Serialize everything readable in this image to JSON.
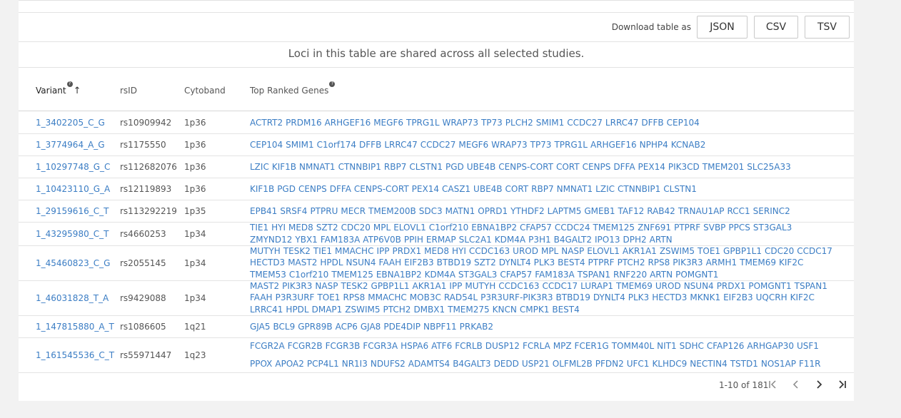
{
  "download": {
    "label": "Download table as",
    "buttons": [
      "JSON",
      "CSV",
      "TSV"
    ]
  },
  "notice": "Loci in this table are shared across all selected studies.",
  "columns": {
    "variant": "Variant",
    "rsid": "rsID",
    "cytoband": "Cytoband",
    "genes": "Top Ranked Genes"
  },
  "rows": [
    {
      "variant": "1_3402205_C_G",
      "rsid": "rs10909942",
      "cytoband": "1p36",
      "genes": [
        "ACTRT2",
        "PRDM16",
        "ARHGEF16",
        "MEGF6",
        "TPRG1L",
        "WRAP73",
        "TP73",
        "PLCH2",
        "SMIM1",
        "CCDC27",
        "LRRC47",
        "DFFB",
        "CEP104"
      ]
    },
    {
      "variant": "1_3774964_A_G",
      "rsid": "rs1175550",
      "cytoband": "1p36",
      "genes": [
        "CEP104",
        "SMIM1",
        "C1orf174",
        "DFFB",
        "LRRC47",
        "CCDC27",
        "MEGF6",
        "WRAP73",
        "TP73",
        "TPRG1L",
        "ARHGEF16",
        "NPHP4",
        "KCNAB2"
      ]
    },
    {
      "variant": "1_10297748_G_C",
      "rsid": "rs112682076",
      "cytoband": "1p36",
      "genes": [
        "LZIC",
        "KIF1B",
        "NMNAT1",
        "CTNNBIP1",
        "RBP7",
        "CLSTN1",
        "PGD",
        "UBE4B",
        "CENPS-CORT",
        "CORT",
        "CENPS",
        "DFFA",
        "PEX14",
        "PIK3CD",
        "TMEM201",
        "SLC25A33"
      ]
    },
    {
      "variant": "1_10423110_G_A",
      "rsid": "rs12119893",
      "cytoband": "1p36",
      "genes": [
        "KIF1B",
        "PGD",
        "CENPS",
        "DFFA",
        "CENPS-CORT",
        "PEX14",
        "CASZ1",
        "UBE4B",
        "CORT",
        "RBP7",
        "NMNAT1",
        "LZIC",
        "CTNNBIP1",
        "CLSTN1"
      ]
    },
    {
      "variant": "1_29159616_C_T",
      "rsid": "rs113292219",
      "cytoband": "1p35",
      "genes": [
        "EPB41",
        "SRSF4",
        "PTPRU",
        "MECR",
        "TMEM200B",
        "SDC3",
        "MATN1",
        "OPRD1",
        "YTHDF2",
        "LAPTM5",
        "GMEB1",
        "TAF12",
        "RAB42",
        "TRNAU1AP",
        "RCC1",
        "SERINC2"
      ]
    },
    {
      "variant": "1_43295980_C_T",
      "rsid": "rs4660253",
      "cytoband": "1p34",
      "genes": [
        "TIE1",
        "HYI",
        "MED8",
        "SZT2",
        "CDC20",
        "MPL",
        "ELOVL1",
        "C1orf210",
        "EBNA1BP2",
        "CFAP57",
        "CCDC24",
        "TMEM125",
        "ZNF691",
        "PTPRF",
        "SVBP",
        "PPCS",
        "ST3GAL3",
        "ZMYND12",
        "YBX1",
        "FAM183A",
        "ATP6V0B",
        "PPIH",
        "ERMAP",
        "SLC2A1",
        "KDM4A",
        "P3H1",
        "B4GALT2",
        "IPO13",
        "DPH2",
        "ARTN"
      ]
    },
    {
      "variant": "1_45460823_C_G",
      "rsid": "rs2055145",
      "cytoband": "1p34",
      "genes": [
        "MUTYH",
        "TESK2",
        "TIE1",
        "MMACHC",
        "IPP",
        "PRDX1",
        "MED8",
        "HYI",
        "CCDC163",
        "UROD",
        "MPL",
        "NASP",
        "ELOVL1",
        "AKR1A1",
        "ZSWIM5",
        "TOE1",
        "GPBP1L1",
        "CDC20",
        "CCDC17",
        "HECTD3",
        "MAST2",
        "HPDL",
        "NSUN4",
        "FAAH",
        "EIF2B3",
        "BTBD19",
        "SZT2",
        "DYNLT4",
        "PLK3",
        "BEST4",
        "PTPRF",
        "PTCH2",
        "RPS8",
        "PIK3R3",
        "ARMH1",
        "TMEM69",
        "KIF2C",
        "TMEM53",
        "C1orf210",
        "TMEM125",
        "EBNA1BP2",
        "KDM4A",
        "ST3GAL3",
        "CFAP57",
        "FAM183A",
        "TSPAN1",
        "RNF220",
        "ARTN",
        "POMGNT1"
      ]
    },
    {
      "variant": "1_46031828_T_A",
      "rsid": "rs9429088",
      "cytoband": "1p34",
      "genes": [
        "MAST2",
        "PIK3R3",
        "NASP",
        "TESK2",
        "GPBP1L1",
        "AKR1A1",
        "IPP",
        "MUTYH",
        "CCDC163",
        "CCDC17",
        "LURAP1",
        "TMEM69",
        "UROD",
        "NSUN4",
        "PRDX1",
        "POMGNT1",
        "TSPAN1",
        "FAAH",
        "P3R3URF",
        "TOE1",
        "RPS8",
        "MMACHC",
        "MOB3C",
        "RAD54L",
        "P3R3URF-PIK3R3",
        "BTBD19",
        "DYNLT4",
        "PLK3",
        "HECTD3",
        "MKNK1",
        "EIF2B3",
        "UQCRH",
        "KIF2C",
        "LRRC41",
        "HPDL",
        "DMAP1",
        "ZSWIM5",
        "PTCH2",
        "DMBX1",
        "TMEM275",
        "KNCN",
        "CMPK1",
        "BEST4"
      ]
    },
    {
      "variant": "1_147815880_A_T",
      "rsid": "rs1086605",
      "cytoband": "1q21",
      "genes": [
        "GJA5",
        "BCL9",
        "GPR89B",
        "ACP6",
        "GJA8",
        "PDE4DIP",
        "NBPF11",
        "PRKAB2"
      ]
    },
    {
      "variant": "1_161545536_C_T",
      "rsid": "rs55971447",
      "cytoband": "1q23",
      "genes": [
        "FCGR2A",
        "FCGR2B",
        "FCGR3B",
        "FCGR3A",
        "HSPA6",
        "ATF6",
        "FCRLB",
        "DUSP12",
        "FCRLA",
        "MPZ",
        "FCER1G",
        "TOMM40L",
        "NIT1",
        "SDHC",
        "CFAP126",
        "ARHGAP30",
        "USF1",
        "PPOX",
        "APOA2",
        "PCP4L1",
        "NR1I3",
        "NDUFS2",
        "ADAMTS4",
        "B4GALT3",
        "DEDD",
        "USP21",
        "OLFML2B",
        "PFDN2",
        "UFC1",
        "KLHDC9",
        "NECTIN4",
        "TSTD1",
        "NOS1AP",
        "F11R"
      ]
    }
  ],
  "pagination": {
    "range": "1-10 of 181"
  }
}
